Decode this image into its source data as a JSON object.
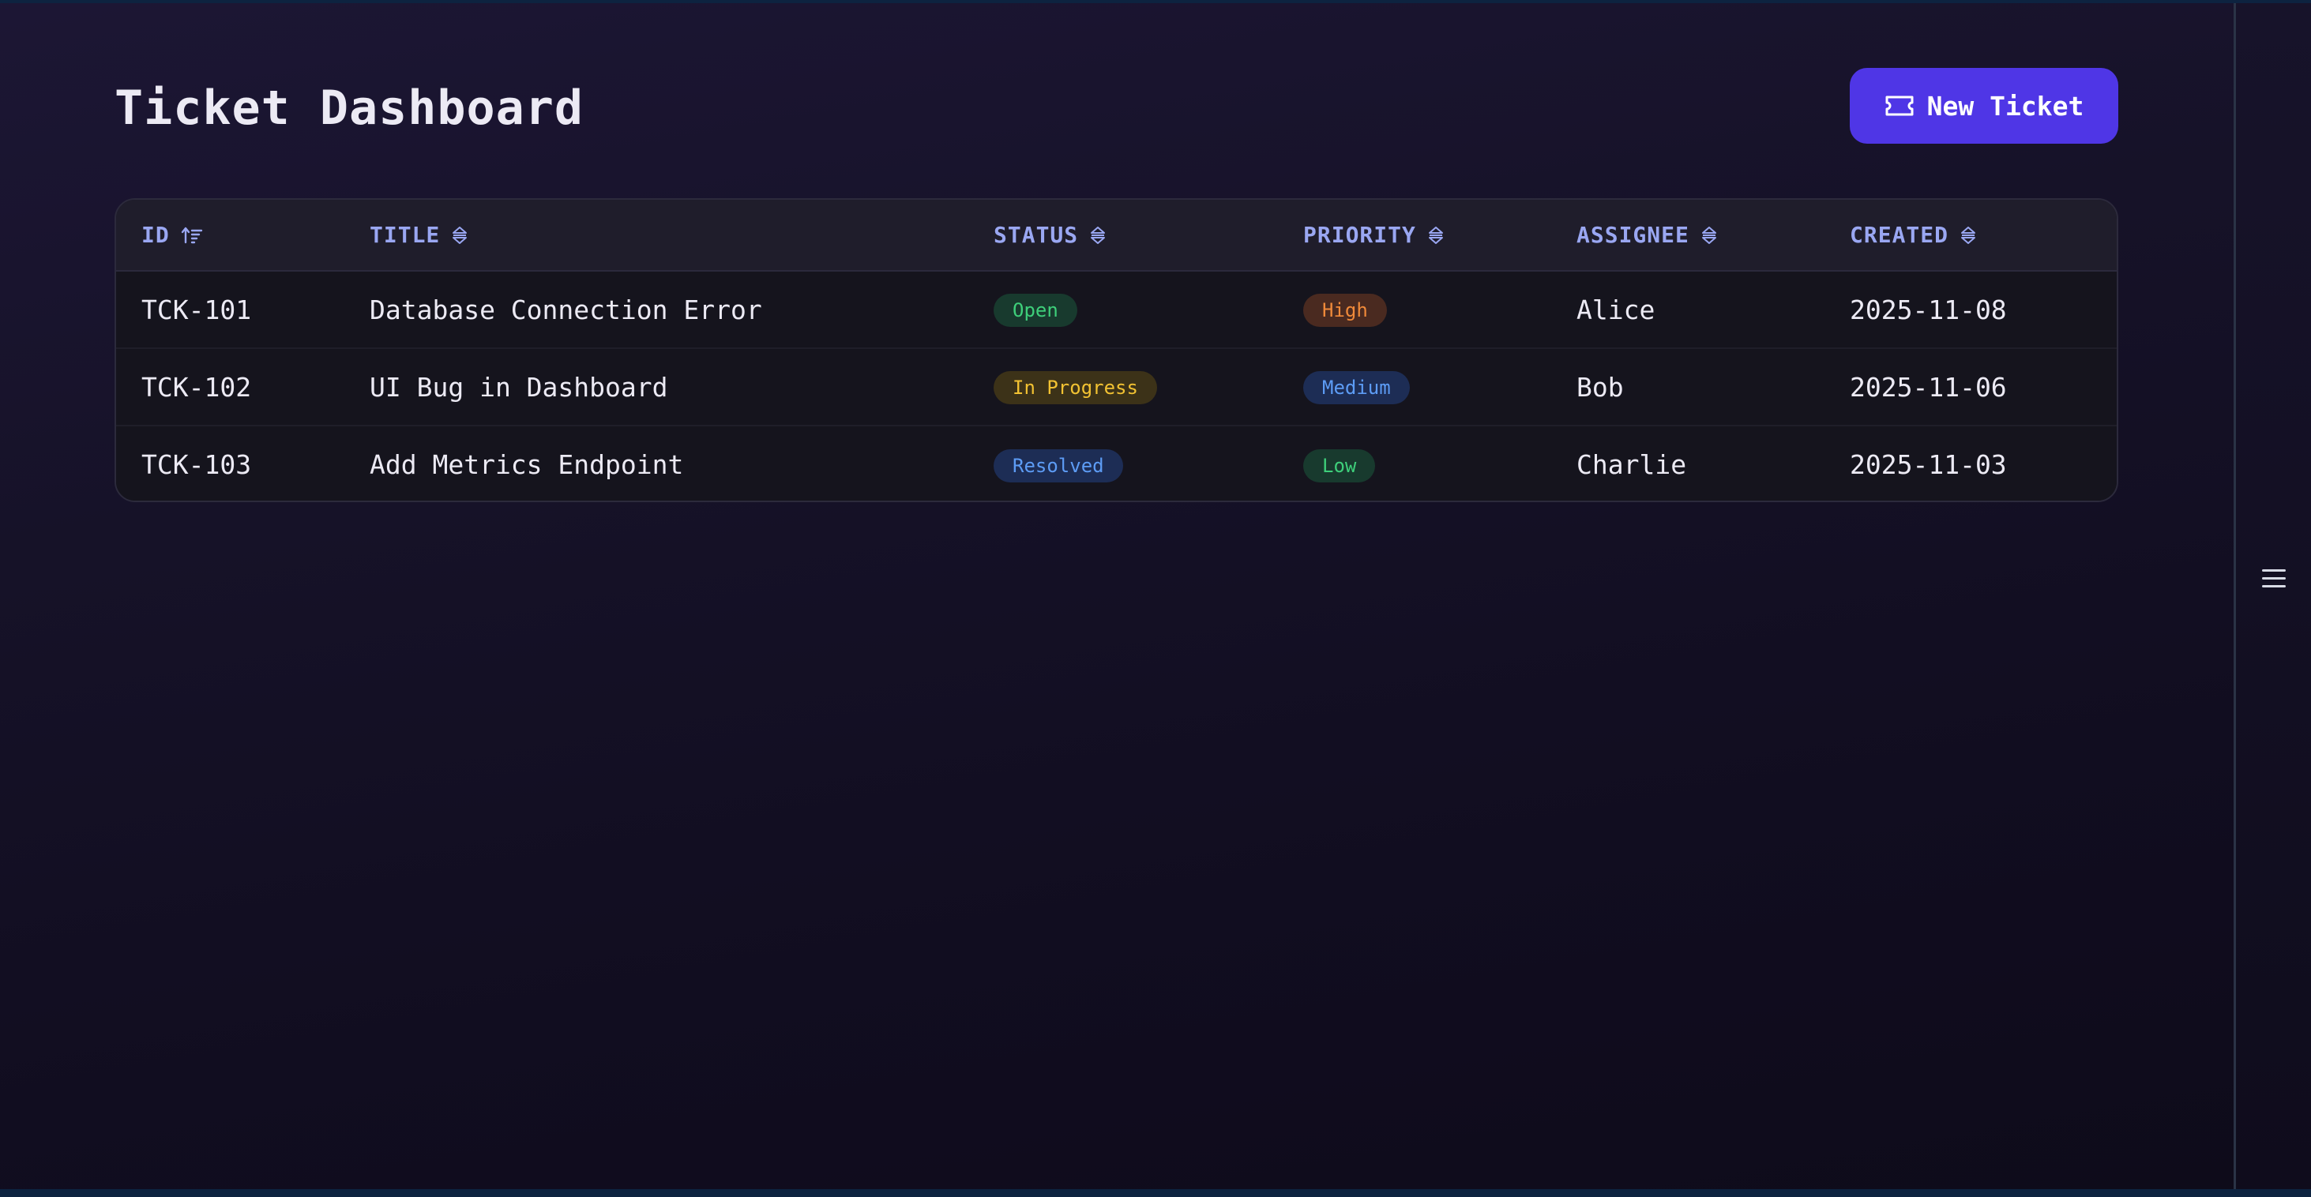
{
  "header": {
    "title": "Ticket Dashboard",
    "new_ticket_label": "New Ticket",
    "new_ticket_icon": "ticket-icon"
  },
  "table": {
    "columns": [
      {
        "label": "ID",
        "sort_icon": "sort-ascending-icon"
      },
      {
        "label": "TITLE",
        "sort_icon": "sort-icon"
      },
      {
        "label": "STATUS",
        "sort_icon": "sort-icon"
      },
      {
        "label": "PRIORITY",
        "sort_icon": "sort-icon"
      },
      {
        "label": "ASSIGNEE",
        "sort_icon": "sort-icon"
      },
      {
        "label": "CREATED",
        "sort_icon": "sort-icon"
      }
    ],
    "rows": [
      {
        "id": "TCK-101",
        "title": "Database Connection Error",
        "status": "Open",
        "priority": "High",
        "assignee": "Alice",
        "created": "2025-11-08"
      },
      {
        "id": "TCK-102",
        "title": "UI Bug in Dashboard",
        "status": "In Progress",
        "priority": "Medium",
        "assignee": "Bob",
        "created": "2025-11-06"
      },
      {
        "id": "TCK-103",
        "title": "Add Metrics Endpoint",
        "status": "Resolved",
        "priority": "Low",
        "assignee": "Charlie",
        "created": "2025-11-03"
      }
    ]
  },
  "sidebar": {
    "menu_icon": "menu-icon"
  },
  "colors": {
    "accent": "#4f36e6",
    "header_text": "#9aa7f2",
    "open": "#3ecf7a",
    "in_progress": "#f2c232",
    "resolved": "#5d9cf5",
    "high": "#f08a3a",
    "medium": "#5d9cf5",
    "low": "#3ecf7a"
  }
}
